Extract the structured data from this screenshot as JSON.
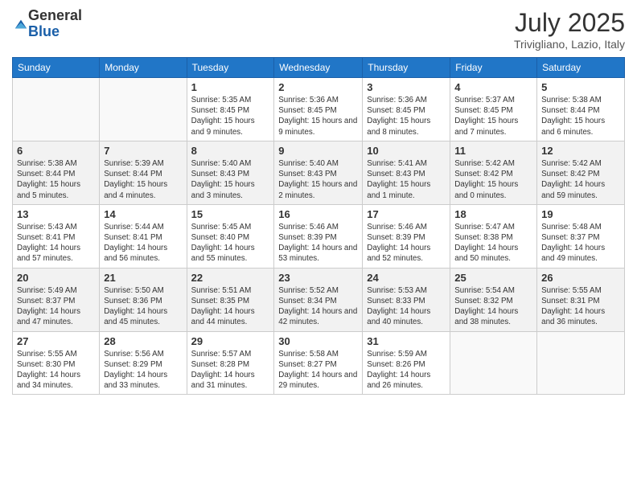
{
  "logo": {
    "general": "General",
    "blue": "Blue"
  },
  "title": {
    "month_year": "July 2025",
    "location": "Trivigliano, Lazio, Italy"
  },
  "days_of_week": [
    "Sunday",
    "Monday",
    "Tuesday",
    "Wednesday",
    "Thursday",
    "Friday",
    "Saturday"
  ],
  "weeks": [
    [
      {
        "day": "",
        "sunrise": "",
        "sunset": "",
        "daylight": "",
        "empty": true
      },
      {
        "day": "",
        "sunrise": "",
        "sunset": "",
        "daylight": "",
        "empty": true
      },
      {
        "day": "1",
        "sunrise": "Sunrise: 5:35 AM",
        "sunset": "Sunset: 8:45 PM",
        "daylight": "Daylight: 15 hours and 9 minutes."
      },
      {
        "day": "2",
        "sunrise": "Sunrise: 5:36 AM",
        "sunset": "Sunset: 8:45 PM",
        "daylight": "Daylight: 15 hours and 9 minutes."
      },
      {
        "day": "3",
        "sunrise": "Sunrise: 5:36 AM",
        "sunset": "Sunset: 8:45 PM",
        "daylight": "Daylight: 15 hours and 8 minutes."
      },
      {
        "day": "4",
        "sunrise": "Sunrise: 5:37 AM",
        "sunset": "Sunset: 8:45 PM",
        "daylight": "Daylight: 15 hours and 7 minutes."
      },
      {
        "day": "5",
        "sunrise": "Sunrise: 5:38 AM",
        "sunset": "Sunset: 8:44 PM",
        "daylight": "Daylight: 15 hours and 6 minutes."
      }
    ],
    [
      {
        "day": "6",
        "sunrise": "Sunrise: 5:38 AM",
        "sunset": "Sunset: 8:44 PM",
        "daylight": "Daylight: 15 hours and 5 minutes."
      },
      {
        "day": "7",
        "sunrise": "Sunrise: 5:39 AM",
        "sunset": "Sunset: 8:44 PM",
        "daylight": "Daylight: 15 hours and 4 minutes."
      },
      {
        "day": "8",
        "sunrise": "Sunrise: 5:40 AM",
        "sunset": "Sunset: 8:43 PM",
        "daylight": "Daylight: 15 hours and 3 minutes."
      },
      {
        "day": "9",
        "sunrise": "Sunrise: 5:40 AM",
        "sunset": "Sunset: 8:43 PM",
        "daylight": "Daylight: 15 hours and 2 minutes."
      },
      {
        "day": "10",
        "sunrise": "Sunrise: 5:41 AM",
        "sunset": "Sunset: 8:43 PM",
        "daylight": "Daylight: 15 hours and 1 minute."
      },
      {
        "day": "11",
        "sunrise": "Sunrise: 5:42 AM",
        "sunset": "Sunset: 8:42 PM",
        "daylight": "Daylight: 15 hours and 0 minutes."
      },
      {
        "day": "12",
        "sunrise": "Sunrise: 5:42 AM",
        "sunset": "Sunset: 8:42 PM",
        "daylight": "Daylight: 14 hours and 59 minutes."
      }
    ],
    [
      {
        "day": "13",
        "sunrise": "Sunrise: 5:43 AM",
        "sunset": "Sunset: 8:41 PM",
        "daylight": "Daylight: 14 hours and 57 minutes."
      },
      {
        "day": "14",
        "sunrise": "Sunrise: 5:44 AM",
        "sunset": "Sunset: 8:41 PM",
        "daylight": "Daylight: 14 hours and 56 minutes."
      },
      {
        "day": "15",
        "sunrise": "Sunrise: 5:45 AM",
        "sunset": "Sunset: 8:40 PM",
        "daylight": "Daylight: 14 hours and 55 minutes."
      },
      {
        "day": "16",
        "sunrise": "Sunrise: 5:46 AM",
        "sunset": "Sunset: 8:39 PM",
        "daylight": "Daylight: 14 hours and 53 minutes."
      },
      {
        "day": "17",
        "sunrise": "Sunrise: 5:46 AM",
        "sunset": "Sunset: 8:39 PM",
        "daylight": "Daylight: 14 hours and 52 minutes."
      },
      {
        "day": "18",
        "sunrise": "Sunrise: 5:47 AM",
        "sunset": "Sunset: 8:38 PM",
        "daylight": "Daylight: 14 hours and 50 minutes."
      },
      {
        "day": "19",
        "sunrise": "Sunrise: 5:48 AM",
        "sunset": "Sunset: 8:37 PM",
        "daylight": "Daylight: 14 hours and 49 minutes."
      }
    ],
    [
      {
        "day": "20",
        "sunrise": "Sunrise: 5:49 AM",
        "sunset": "Sunset: 8:37 PM",
        "daylight": "Daylight: 14 hours and 47 minutes."
      },
      {
        "day": "21",
        "sunrise": "Sunrise: 5:50 AM",
        "sunset": "Sunset: 8:36 PM",
        "daylight": "Daylight: 14 hours and 45 minutes."
      },
      {
        "day": "22",
        "sunrise": "Sunrise: 5:51 AM",
        "sunset": "Sunset: 8:35 PM",
        "daylight": "Daylight: 14 hours and 44 minutes."
      },
      {
        "day": "23",
        "sunrise": "Sunrise: 5:52 AM",
        "sunset": "Sunset: 8:34 PM",
        "daylight": "Daylight: 14 hours and 42 minutes."
      },
      {
        "day": "24",
        "sunrise": "Sunrise: 5:53 AM",
        "sunset": "Sunset: 8:33 PM",
        "daylight": "Daylight: 14 hours and 40 minutes."
      },
      {
        "day": "25",
        "sunrise": "Sunrise: 5:54 AM",
        "sunset": "Sunset: 8:32 PM",
        "daylight": "Daylight: 14 hours and 38 minutes."
      },
      {
        "day": "26",
        "sunrise": "Sunrise: 5:55 AM",
        "sunset": "Sunset: 8:31 PM",
        "daylight": "Daylight: 14 hours and 36 minutes."
      }
    ],
    [
      {
        "day": "27",
        "sunrise": "Sunrise: 5:55 AM",
        "sunset": "Sunset: 8:30 PM",
        "daylight": "Daylight: 14 hours and 34 minutes."
      },
      {
        "day": "28",
        "sunrise": "Sunrise: 5:56 AM",
        "sunset": "Sunset: 8:29 PM",
        "daylight": "Daylight: 14 hours and 33 minutes."
      },
      {
        "day": "29",
        "sunrise": "Sunrise: 5:57 AM",
        "sunset": "Sunset: 8:28 PM",
        "daylight": "Daylight: 14 hours and 31 minutes."
      },
      {
        "day": "30",
        "sunrise": "Sunrise: 5:58 AM",
        "sunset": "Sunset: 8:27 PM",
        "daylight": "Daylight: 14 hours and 29 minutes."
      },
      {
        "day": "31",
        "sunrise": "Sunrise: 5:59 AM",
        "sunset": "Sunset: 8:26 PM",
        "daylight": "Daylight: 14 hours and 26 minutes."
      },
      {
        "day": "",
        "sunrise": "",
        "sunset": "",
        "daylight": "",
        "empty": true
      },
      {
        "day": "",
        "sunrise": "",
        "sunset": "",
        "daylight": "",
        "empty": true
      }
    ]
  ]
}
